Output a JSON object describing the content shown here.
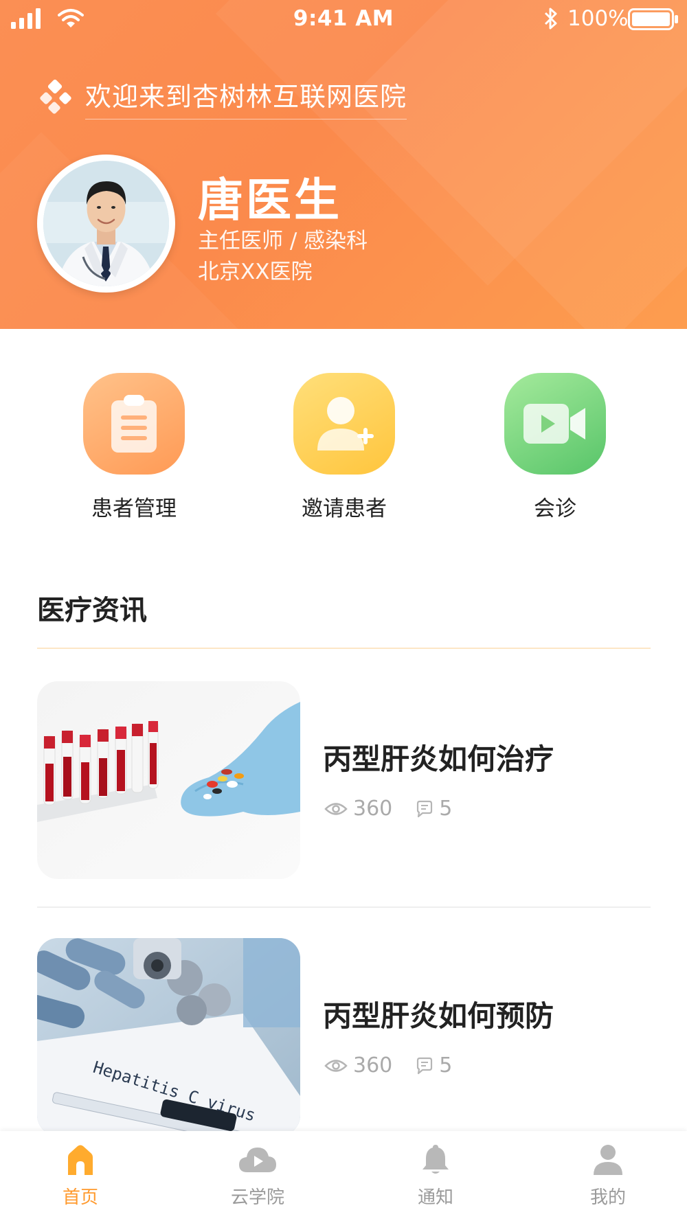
{
  "status_bar": {
    "time": "9:41 AM",
    "battery_pct": "100%"
  },
  "header": {
    "welcome": "欢迎来到杏树林互联网医院"
  },
  "doctor": {
    "name": "唐医生",
    "title": "主任医师 / 感染科",
    "hospital": "北京XX医院"
  },
  "actions": [
    {
      "label": "患者管理",
      "icon": "clipboard-icon",
      "color": "#ff9e5c"
    },
    {
      "label": "邀请患者",
      "icon": "add-user-icon",
      "color": "#ffc53d"
    },
    {
      "label": "会诊",
      "icon": "video-icon",
      "color": "#5cc66b"
    }
  ],
  "news": {
    "section_title": "医疗资讯",
    "items": [
      {
        "title": "丙型肝炎如何治疗",
        "views": "360",
        "comments": "5",
        "image": "blood-tubes-and-pills-photo"
      },
      {
        "title": "丙型肝炎如何预防",
        "views": "360",
        "comments": "5",
        "image": "hepatitis-c-virus-photo"
      }
    ]
  },
  "tabbar": {
    "accent": "#ff9a2e",
    "tabs": [
      {
        "label": "首页",
        "icon": "home-icon",
        "active": true
      },
      {
        "label": "云学院",
        "icon": "cloud-play-icon",
        "active": false
      },
      {
        "label": "通知",
        "icon": "bell-icon",
        "active": false
      },
      {
        "label": "我的",
        "icon": "person-icon",
        "active": false
      }
    ]
  }
}
